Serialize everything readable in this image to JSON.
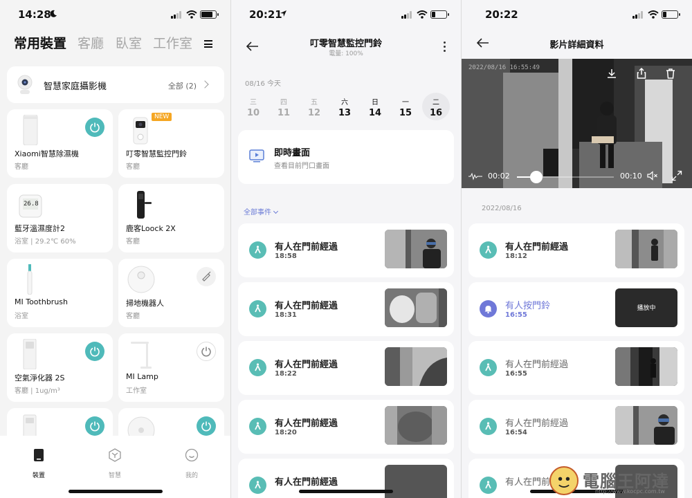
{
  "screen1": {
    "status": {
      "time": "14:28"
    },
    "tabs": [
      {
        "label": "常用裝置",
        "active": true
      },
      {
        "label": "客廳",
        "active": false
      },
      {
        "label": "臥室",
        "active": false
      },
      {
        "label": "工作室",
        "active": false
      }
    ],
    "camera_bar": {
      "label": "智慧家庭攝影機",
      "count": "全部 (2)"
    },
    "devices": [
      {
        "name": "Xiaomi智慧除濕機",
        "room": "客廳",
        "power": "on"
      },
      {
        "name": "叮零智慧監控門鈴",
        "room": "客廳",
        "badge": "NEW"
      },
      {
        "name": "藍牙溫濕度計2",
        "room": "浴室 | 29.2℃ 60%",
        "display": "26.8"
      },
      {
        "name": "鹿客Loock 2X",
        "room": "客廳"
      },
      {
        "name": "MI Toothbrush",
        "room": "浴室"
      },
      {
        "name": "掃地機器人",
        "room": "客廳"
      },
      {
        "name": "空氣淨化器 2S",
        "room": "客廳 | 1ug/m³",
        "power": "on"
      },
      {
        "name": "MI Lamp",
        "room": "工作室",
        "power": "off"
      },
      {
        "name": "",
        "room": "",
        "power": "on"
      },
      {
        "name": "",
        "room": "",
        "power": "on"
      }
    ],
    "tabbar": [
      {
        "label": "裝置",
        "icon": "device-icon",
        "active": true
      },
      {
        "label": "智慧",
        "icon": "smart-icon",
        "active": false
      },
      {
        "label": "我的",
        "icon": "profile-icon",
        "active": false
      }
    ]
  },
  "screen2": {
    "status": {
      "time": "20:21"
    },
    "title": "叮零智慧監控門鈴",
    "subtitle": "電量: 100%",
    "date_label": "08/16 今天",
    "week": [
      {
        "wd": "三",
        "dn": "10"
      },
      {
        "wd": "四",
        "dn": "11"
      },
      {
        "wd": "五",
        "dn": "12"
      },
      {
        "wd": "六",
        "dn": "13"
      },
      {
        "wd": "日",
        "dn": "14"
      },
      {
        "wd": "一",
        "dn": "15"
      },
      {
        "wd": "二",
        "dn": "16"
      }
    ],
    "live": {
      "title": "即時畫面",
      "desc": "查看目前門口畫面"
    },
    "filter": "全部事件",
    "events": [
      {
        "title": "有人在門前經過",
        "time": "18:58"
      },
      {
        "title": "有人在門前經過",
        "time": "18:31"
      },
      {
        "title": "有人在門前經過",
        "time": "18:22"
      },
      {
        "title": "有人在門前經過",
        "time": "18:20"
      },
      {
        "title": "有人在門前經過",
        "time": ""
      }
    ]
  },
  "screen3": {
    "status": {
      "time": "20:22"
    },
    "title": "影片詳細資料",
    "video": {
      "timestamp": "2022/08/16 16:55:49",
      "current": "00:02",
      "duration": "00:10",
      "progress": 0.2
    },
    "date": "2022/08/16",
    "events": [
      {
        "title": "有人在門前經過",
        "time": "18:12",
        "type": "motion"
      },
      {
        "title": "有人按門鈴",
        "time": "16:55",
        "type": "ring",
        "overlay": "播放中"
      },
      {
        "title": "有人在門前經過",
        "time": "16:55",
        "type": "motion"
      },
      {
        "title": "有人在門前經過",
        "time": "16:54",
        "type": "motion"
      },
      {
        "title": "有人在門前經過",
        "time": "",
        "type": "motion"
      }
    ]
  },
  "watermark": {
    "name": "電腦王阿達",
    "url": "http://www.kocpc.com.tw"
  }
}
